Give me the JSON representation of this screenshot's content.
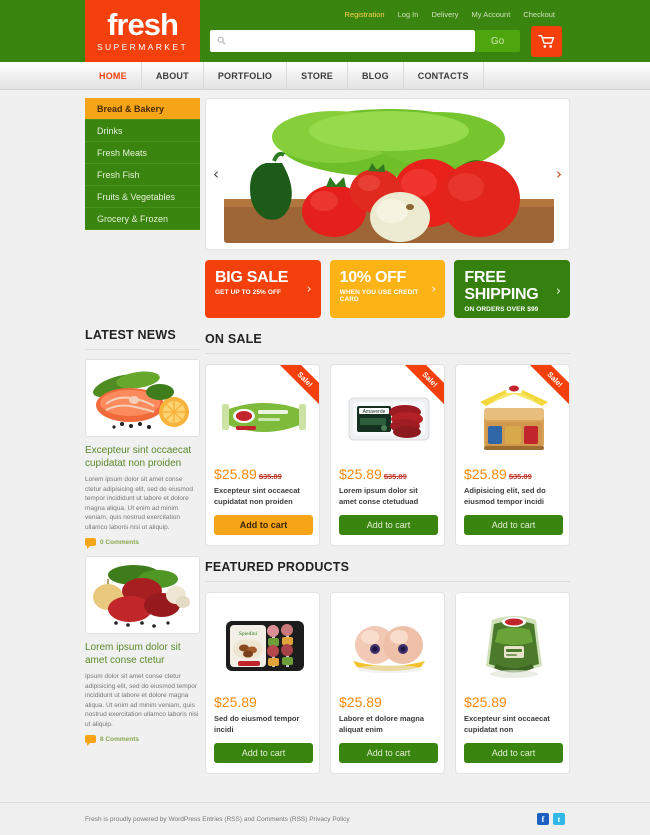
{
  "header": {
    "logo_main": "fresh",
    "logo_sub": "SUPERMARKET",
    "top_links": [
      {
        "label": "Registration",
        "active": true
      },
      {
        "label": "Log In",
        "active": false
      },
      {
        "label": "Delivery",
        "active": false
      },
      {
        "label": "My Account",
        "active": false
      },
      {
        "label": "Checkout",
        "active": false
      }
    ],
    "search": {
      "value": "",
      "placeholder": "",
      "icon": "search-icon"
    },
    "go_label": "Go",
    "cart_icon": "shopping-cart-icon",
    "brand_green": "#3a8410",
    "brand_red": "#f4400c"
  },
  "nav": {
    "items": [
      {
        "label": "HOME",
        "active": true
      },
      {
        "label": "ABOUT",
        "active": false
      },
      {
        "label": "PORTFOLIO",
        "active": false
      },
      {
        "label": "STORE",
        "active": false
      },
      {
        "label": "BLOG",
        "active": false
      },
      {
        "label": "CONTACTS",
        "active": false
      }
    ]
  },
  "sidebar": {
    "categories": [
      {
        "label": "Bread & Bakery",
        "active": true
      },
      {
        "label": "Drinks",
        "active": false
      },
      {
        "label": "Fresh Meats",
        "active": false
      },
      {
        "label": "Fresh Fish",
        "active": false
      },
      {
        "label": "Fruits & Vegetables",
        "active": false
      },
      {
        "label": "Grocery & Frozen",
        "active": false
      }
    ],
    "latest_news_title": "LATEST NEWS",
    "news": [
      {
        "image": "salmon-steaks-photo",
        "title": "Excepteur sint occaecat cupidatat non proiden",
        "text": "Lorem ipsum dolor sit amet conse ctetur adipisicing elit, sed do eiusmod tempor incididunt ut labore et dolore magna aliqua. Ut enim ad minim veniam, quis nostrud exercitation ullamco laboris nisi ut aliquip.",
        "comments": "0 Comments"
      },
      {
        "image": "raw-beef-photo",
        "title": "Lorem ipsum dolor sit amet conse ctetur",
        "text": "Ipsum dolor sit amet conse ctetur adipisicing elit, sed do eiusmod tempor incididunt ut labore et dolore magna aliqua. Ut enim ad minim veniam, quis nostrud exercitation ullamco laboris nisi ut aliquip.",
        "comments": "8 Comments"
      }
    ]
  },
  "slider": {
    "image": "fresh-vegetables-peppers-tomatoes-photo",
    "prev_icon": "chevron-left-icon",
    "next_icon": "chevron-right-icon",
    "prev_glyph": "‹",
    "next_glyph": "›"
  },
  "promos": [
    {
      "big": "BIG SALE",
      "small": "GET UP TO 25% OFF",
      "color": "#f4400c",
      "style": "red"
    },
    {
      "big": "10% OFF",
      "small": "WHEN YOU USE CREDIT CARD",
      "color": "#fbb316",
      "style": "amber"
    },
    {
      "big": "FREE SHIPPING",
      "small": "ON ORDERS OVER $99",
      "color": "#35800f",
      "style": "green"
    }
  ],
  "on_sale": {
    "title": "ON SALE",
    "ribbon_label": "Sale!",
    "products": [
      {
        "image": "green-packaged-product",
        "price": "$25.89",
        "old_price": "$35.89",
        "desc": "Excepteur sint occaecat cupidatat non proiden",
        "button": "Add to cart",
        "button_style": "amber"
      },
      {
        "image": "sliced-red-meat-tray",
        "price": "$25.89",
        "old_price": "$35.89",
        "desc": "Lorem ipsum dolor sit amet conse ctetuduad",
        "button": "Add to cart",
        "button_style": "green"
      },
      {
        "image": "sliced-bread-loaf-package",
        "price": "$25.89",
        "old_price": "$35.89",
        "desc": "Adipisicing elit, sed do eiusmod tempor incidi",
        "button": "Add to cart",
        "button_style": "green"
      }
    ]
  },
  "featured": {
    "title": "FEATURED PRODUCTS",
    "products": [
      {
        "image": "meat-skewers-tray",
        "price": "$25.89",
        "desc": "Sed do eiusmod tempor incidi",
        "button": "Add to cart",
        "button_style": "green"
      },
      {
        "image": "whole-chickens-tray",
        "price": "$25.89",
        "desc": "Labore et dolore magna aliquat enim",
        "button": "Add to cart",
        "button_style": "green"
      },
      {
        "image": "green-salad-bag",
        "price": "$25.89",
        "desc": "Excepteur sint occaecat cupidatat non",
        "button": "Add to cart",
        "button_style": "green"
      }
    ]
  },
  "footer": {
    "text": "Fresh is proudly powered by WordPress Entries (RSS) and Comments (RSS) Privacy Policy",
    "social": [
      {
        "name": "facebook-icon",
        "glyph": "f",
        "style": "fb"
      },
      {
        "name": "twitter-icon",
        "glyph": "t",
        "style": "tw"
      }
    ]
  }
}
